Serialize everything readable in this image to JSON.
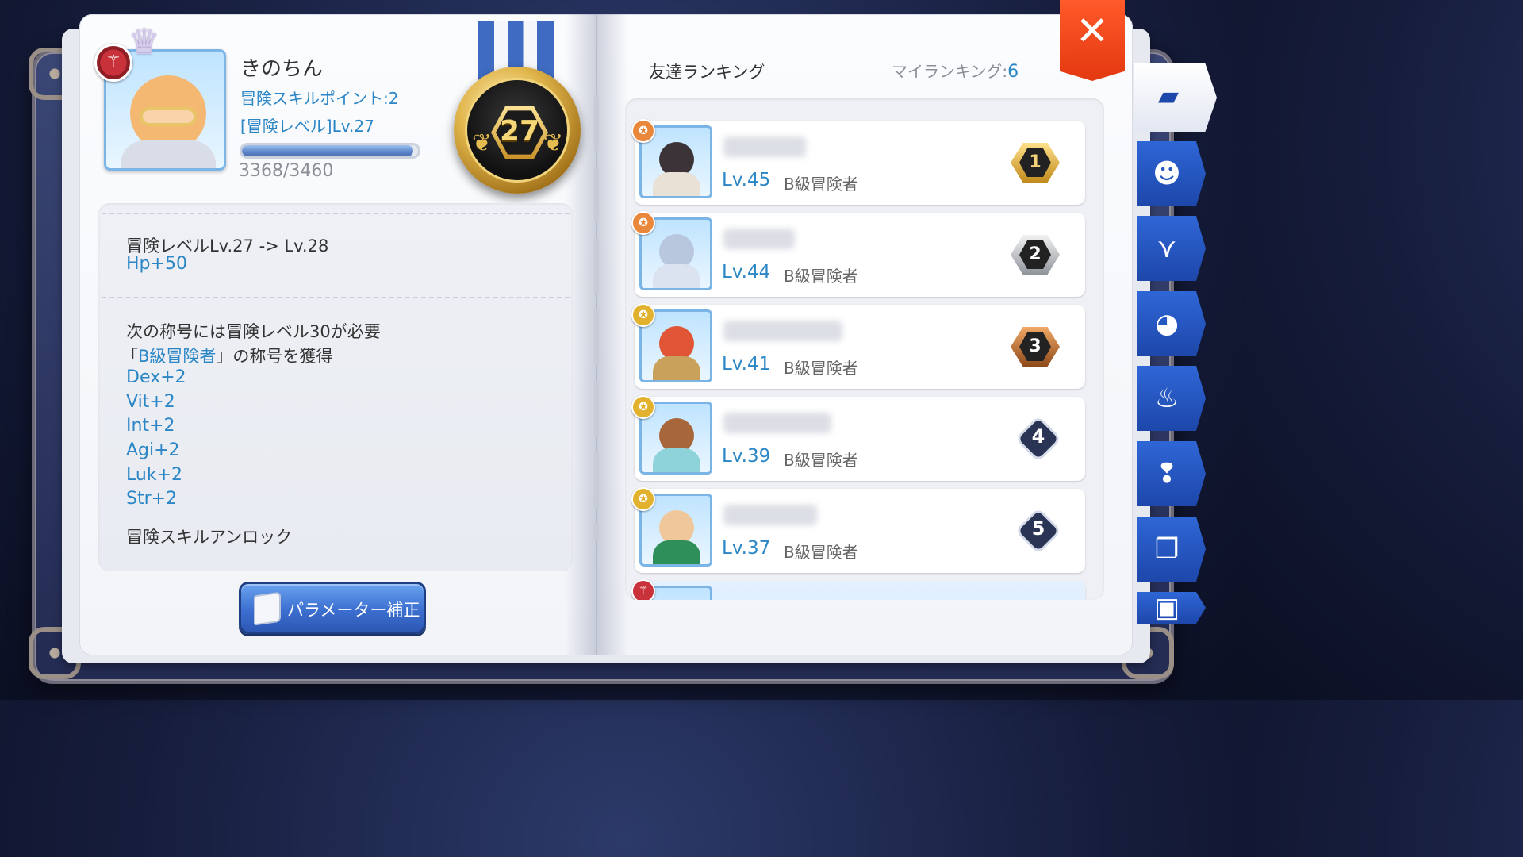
{
  "player": {
    "name": "きのちん",
    "skill_points": "冒険スキルポイント:2",
    "adventure_level": "[冒険レベル]Lv.27",
    "xp_text": "3368/3460",
    "xp_fraction": 0.973,
    "medal_level": "27",
    "job_badge_icon": "guild-emblem-icon",
    "avatar_icon": "crown-character-icon"
  },
  "level_info": {
    "level_up": "冒険レベルLv.27  ->  Lv.28",
    "hp_bonus": "Hp+50",
    "next_title_req": "次の称号には冒険レベル30が必要",
    "title_prefix": "「",
    "title_name": "B級冒険者",
    "title_suffix": "」の称号を獲得",
    "stat_bonuses": [
      "Dex+2",
      "Vit+2",
      "Int+2",
      "Agi+2",
      "Luk+2",
      "Str+2"
    ],
    "unlock_text": "冒険スキルアンロック"
  },
  "buttons": {
    "param_adjust": "パラメーター補正"
  },
  "ranking": {
    "title": "友達ランキング",
    "my_rank_label": "マイランキング:",
    "my_rank_value": "6",
    "entries": [
      {
        "level": "Lv.45",
        "title": "B級冒険者",
        "rank": "1"
      },
      {
        "level": "Lv.44",
        "title": "B級冒険者",
        "rank": "2"
      },
      {
        "level": "Lv.41",
        "title": "B級冒険者",
        "rank": "3"
      },
      {
        "level": "Lv.39",
        "title": "B級冒険者",
        "rank": "4"
      },
      {
        "level": "Lv.37",
        "title": "B級冒険者",
        "rank": "5"
      }
    ]
  },
  "close_glyph": "✕",
  "side_tabs": [
    {
      "icon": "book-icon",
      "glyph": "▰",
      "active": true
    },
    {
      "icon": "cat-face-icon",
      "glyph": "☻",
      "active": false
    },
    {
      "icon": "horns-icon",
      "glyph": "⋎",
      "active": false
    },
    {
      "icon": "pet-face-icon",
      "glyph": "◕",
      "active": false
    },
    {
      "icon": "chef-hat-icon",
      "glyph": "♨",
      "active": false
    },
    {
      "icon": "quest-head-icon",
      "glyph": "❢",
      "active": false
    },
    {
      "icon": "open-book-icon",
      "glyph": "❐",
      "active": false
    },
    {
      "icon": "card-icon",
      "glyph": "▣",
      "active": false
    }
  ],
  "colors": {
    "accent_blue": "#2b86c6",
    "tab_blue": "#2f66d6",
    "close_red": "#e33810",
    "medal_gold": "#e1b64c"
  }
}
